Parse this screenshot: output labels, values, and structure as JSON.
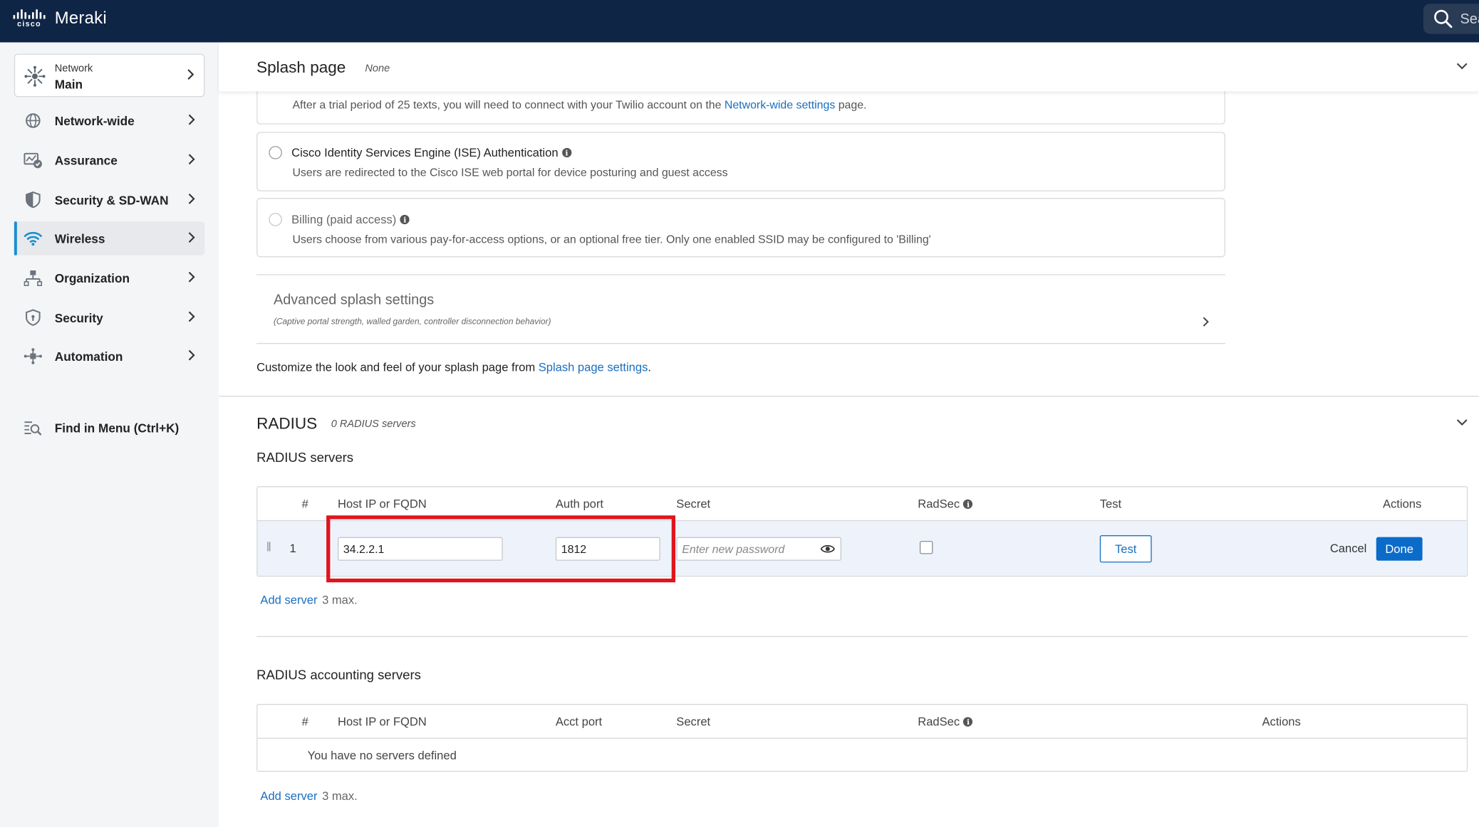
{
  "topbar": {
    "brand_word": "cisco",
    "app_name": "Meraki",
    "search_placeholder": "Sea"
  },
  "sidebar": {
    "network_selector": {
      "label": "Network",
      "value": "Main"
    },
    "items": [
      {
        "label": "Network-wide",
        "icon": "network-wide-icon"
      },
      {
        "label": "Assurance",
        "icon": "assurance-icon"
      },
      {
        "label": "Security & SD-WAN",
        "icon": "shield-half-icon"
      },
      {
        "label": "Wireless",
        "icon": "wifi-icon",
        "active": true
      },
      {
        "label": "Organization",
        "icon": "organization-icon"
      },
      {
        "label": "Security",
        "icon": "shield-icon"
      },
      {
        "label": "Automation",
        "icon": "automation-icon"
      }
    ],
    "find_in_menu": "Find in Menu (Ctrl+K)"
  },
  "splash": {
    "title": "Splash page",
    "status": "None",
    "twilio_note_prefix": "After a trial period of 25 texts, you will need to connect with your Twilio account on the ",
    "twilio_link": "Network-wide settings",
    "twilio_note_suffix": " page.",
    "options": [
      {
        "title": "Cisco Identity Services Engine (ISE) Authentication",
        "desc": "Users are redirected to the Cisco ISE web portal for device posturing and guest access",
        "enabled": true
      },
      {
        "title": "Billing (paid access)",
        "desc": "Users choose from various pay-for-access options, or an optional free tier. Only one enabled SSID may be configured to 'Billing'",
        "enabled": false
      }
    ],
    "advanced_title": "Advanced splash settings",
    "advanced_sub": "(Captive portal strength, walled garden, controller disconnection behavior)",
    "customize_prefix": "Customize the look and feel of your splash page from ",
    "customize_link": "Splash page settings",
    "customize_suffix": "."
  },
  "radius": {
    "title": "RADIUS",
    "count": "0 RADIUS servers",
    "servers_label": "RADIUS servers",
    "columns": [
      "#",
      "Host IP or FQDN",
      "Auth port",
      "Secret",
      "RadSec",
      "Test",
      "Actions"
    ],
    "row": {
      "index": "1",
      "host": "34.2.2.1",
      "port": "1812",
      "secret_placeholder": "Enter new password",
      "test_label": "Test",
      "cancel_label": "Cancel",
      "done_label": "Done"
    },
    "add_server": "Add server",
    "max_note": "3 max.",
    "accounting_label": "RADIUS accounting servers",
    "accounting_columns": [
      "#",
      "Host IP or FQDN",
      "Acct port",
      "Secret",
      "RadSec",
      "Actions"
    ],
    "accounting_empty": "You have no servers defined"
  },
  "colors": {
    "topbar": "#0f2546",
    "accent": "#1a8fd0",
    "link": "#1a6fbf",
    "primary_button": "#0b6bc8",
    "highlight": "#e0141c"
  }
}
